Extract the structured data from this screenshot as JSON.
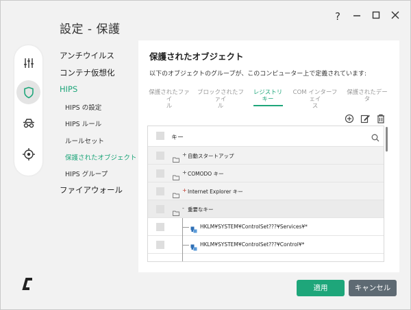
{
  "window": {
    "title": "設定 - 保護"
  },
  "nav": {
    "items": [
      {
        "label": "アンチウイルス"
      },
      {
        "label": "コンテナ仮想化"
      },
      {
        "label": "HIPS"
      },
      {
        "label": "HIPS の設定"
      },
      {
        "label": "HIPS ルール"
      },
      {
        "label": "ルールセット"
      },
      {
        "label": "保護されたオブジェクト"
      },
      {
        "label": "HIPS グループ"
      },
      {
        "label": "ファイアウォール"
      }
    ]
  },
  "panel": {
    "title": "保護されたオブジェクト",
    "description": "以下のオブジェクトのグループが、このコンピューター上で定義されています:",
    "tabs": [
      {
        "line1": "保護されたファイ",
        "line2": "ル"
      },
      {
        "line1": "ブロックされたファイ",
        "line2": "ル"
      },
      {
        "line1": "レジストリ",
        "line2": "キー"
      },
      {
        "line1": "COM インターフェイ",
        "line2": "ス"
      },
      {
        "line1": "保護されたデー",
        "line2": "タ"
      }
    ],
    "list": {
      "header": "キー",
      "rows": [
        {
          "sign": "+",
          "label": "自動スタートアップ"
        },
        {
          "sign": "+",
          "label": "COMODO キー"
        },
        {
          "sign": "+",
          "label": "Internet Explorer キー"
        },
        {
          "sign": "-",
          "label": "重要なキー"
        },
        {
          "label": "HKLM¥SYSTEM¥ControlSet???¥Services¥*"
        },
        {
          "label": "HKLM¥SYSTEM¥ControlSet???¥Control¥*"
        }
      ]
    }
  },
  "footer": {
    "apply_label": "適用",
    "cancel_label": "キャンセル"
  },
  "colors": {
    "accent": "#1ea67a",
    "cancel": "#5e6a73"
  }
}
